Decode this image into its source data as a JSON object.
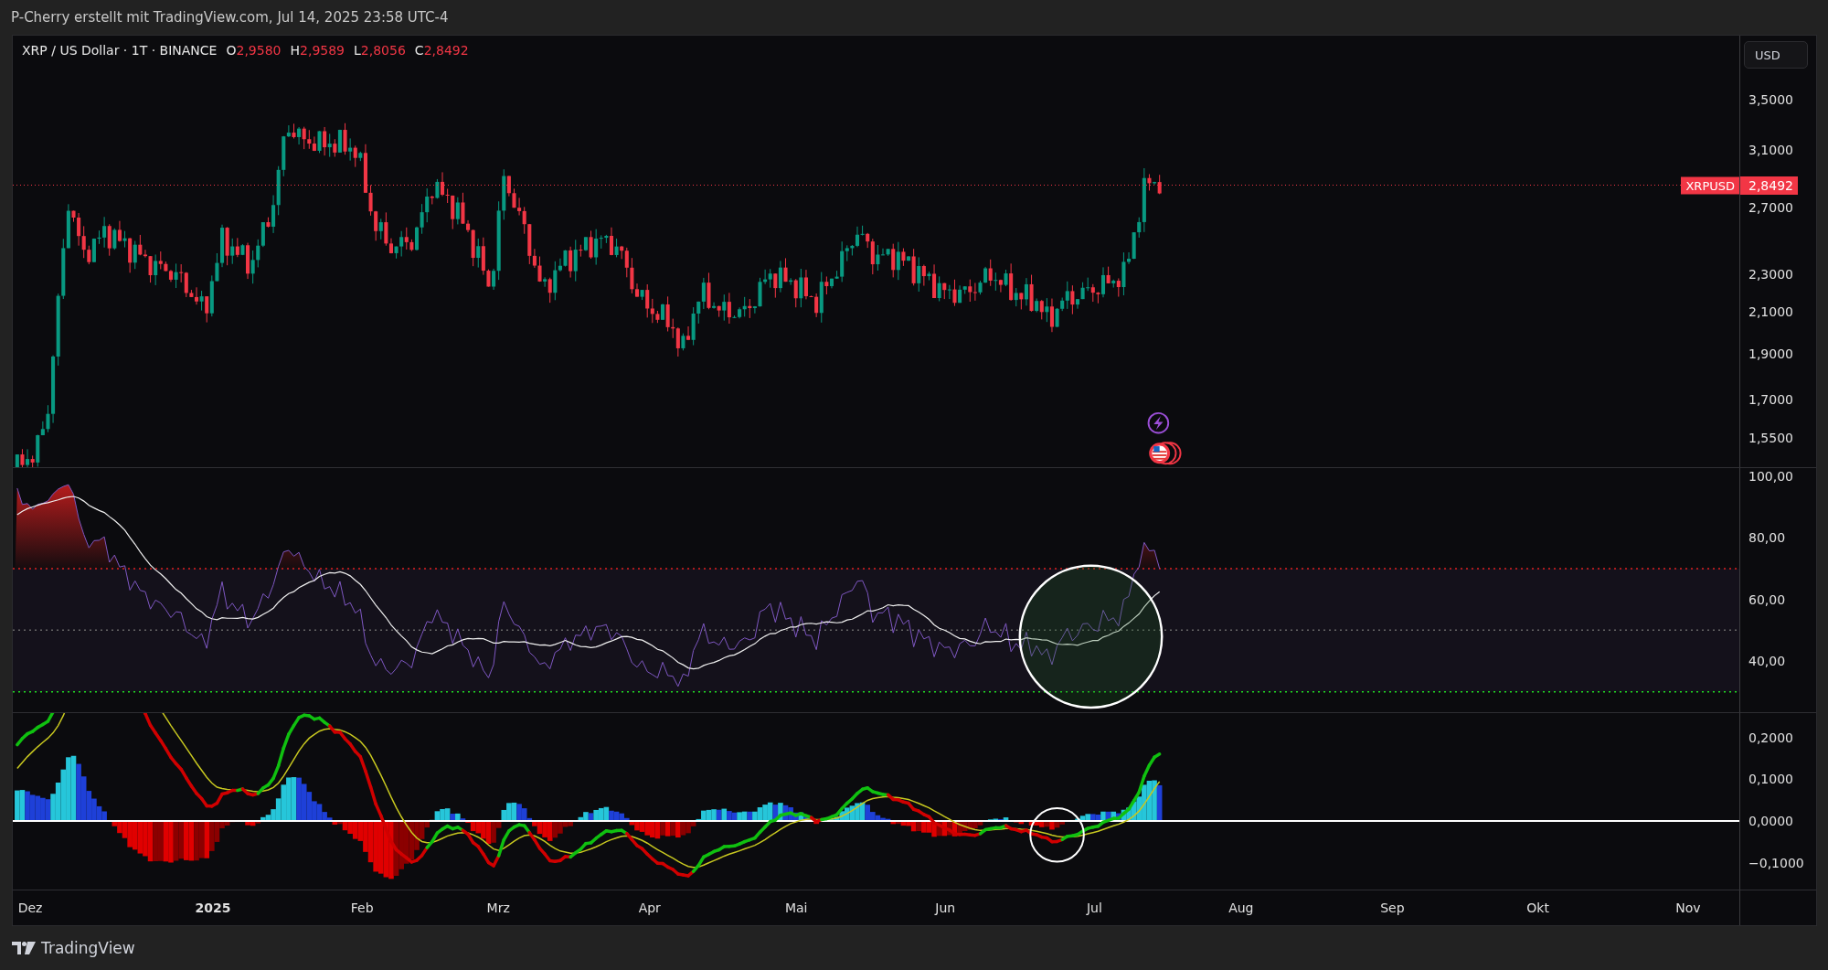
{
  "header": {
    "attribution": "P-Cherry erstellt mit TradingView.com, Jul 14, 2025 23:58 UTC-4"
  },
  "legend": {
    "symbol": "XRP / US Dollar · 1T · BINANCE",
    "ohlc": [
      {
        "key": "O",
        "value": "2,9580"
      },
      {
        "key": "H",
        "value": "2,9589"
      },
      {
        "key": "L",
        "value": "2,8056"
      },
      {
        "key": "C",
        "value": "2,8492"
      }
    ]
  },
  "price_axis": {
    "currency": "USD",
    "ticks": [
      "3,5000",
      "3,1000",
      "2,7000",
      "2,3000",
      "2,1000",
      "1,9000",
      "1,7000",
      "1,5500"
    ],
    "last_price": {
      "symbol": "XRPUSD",
      "value": "2,8492"
    }
  },
  "rsi_axis": {
    "ticks": [
      "100,00",
      "80,00",
      "60,00",
      "40,00"
    ]
  },
  "macd_axis": {
    "ticks": [
      "0,2000",
      "0,1000",
      "0,0000",
      "−0,1000"
    ]
  },
  "time_axis": {
    "labels": [
      {
        "text": "Dez",
        "kind": "month"
      },
      {
        "text": "2025",
        "kind": "year"
      },
      {
        "text": "Feb",
        "kind": "month"
      },
      {
        "text": "Mrz",
        "kind": "month"
      },
      {
        "text": "Apr",
        "kind": "month"
      },
      {
        "text": "Mai",
        "kind": "month"
      },
      {
        "text": "Jun",
        "kind": "month"
      },
      {
        "text": "Jul",
        "kind": "month"
      },
      {
        "text": "Aug",
        "kind": "month"
      },
      {
        "text": "Sep",
        "kind": "month"
      },
      {
        "text": "Okt",
        "kind": "month"
      },
      {
        "text": "Nov",
        "kind": "month"
      }
    ]
  },
  "footer": {
    "brand": "TradingView"
  }
}
